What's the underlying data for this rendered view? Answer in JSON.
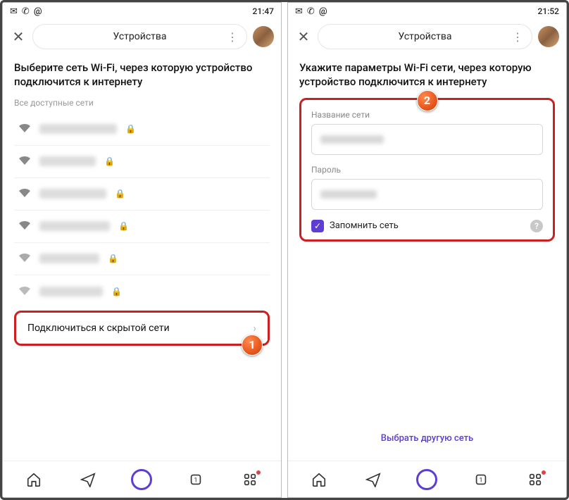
{
  "left": {
    "status": {
      "time": "21:47"
    },
    "appbar": {
      "title": "Устройства"
    },
    "heading": "Выберите сеть Wi-Fi, через которую устройство подключится к интернету",
    "subheading": "Все доступные сети",
    "hidden_network_label": "Подключиться к скрытой сети",
    "callout": "1"
  },
  "right": {
    "status": {
      "time": "21:52"
    },
    "appbar": {
      "title": "Устройства"
    },
    "heading": "Укажите параметры Wi-Fi сети, через которую устройство подключится к интернету",
    "form": {
      "ssid_label": "Название сети",
      "password_label": "Пароль",
      "remember_label": "Запомнить сеть"
    },
    "choose_other": "Выбрать другую сеть",
    "callout": "2"
  }
}
